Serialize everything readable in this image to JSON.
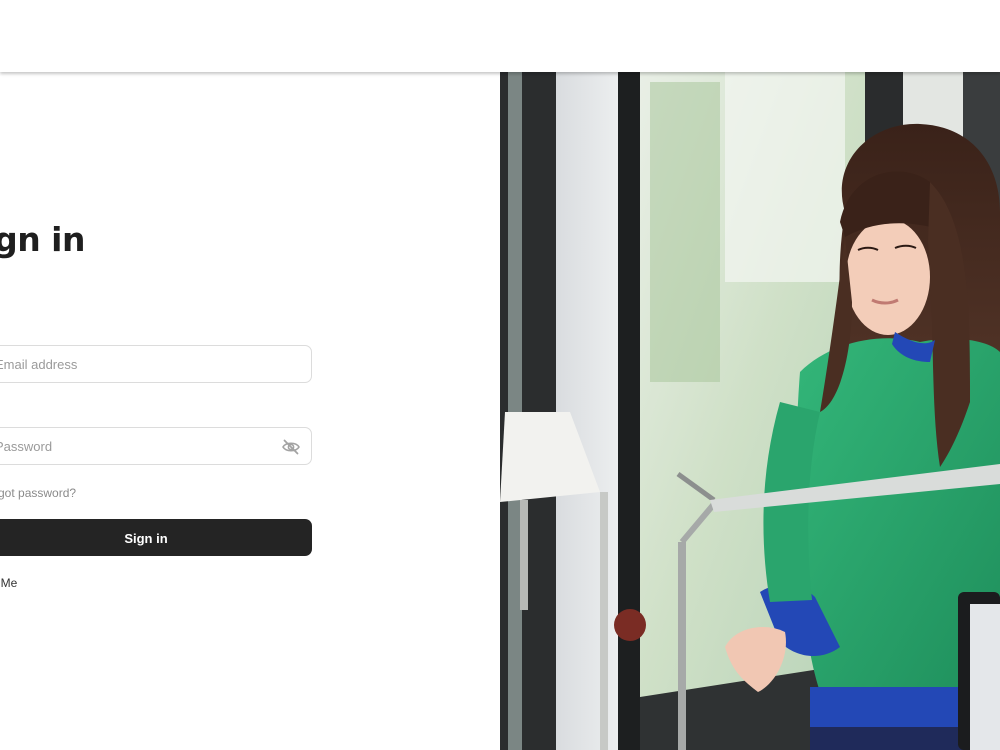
{
  "signin": {
    "title": "Sign in",
    "email_placeholder": "Email address",
    "password_placeholder": "Password",
    "forgot_label": "Forgot password?",
    "submit_label": "Sign in",
    "remember_label": "Remember Me"
  },
  "hero": {
    "alt": "Woman in a green sweater looking out an office window"
  },
  "colors": {
    "button_bg": "#242424",
    "sweater": "#2aa56d",
    "shirt": "#2348b6"
  },
  "icons": {
    "password_toggle": "eye-slash-icon"
  }
}
